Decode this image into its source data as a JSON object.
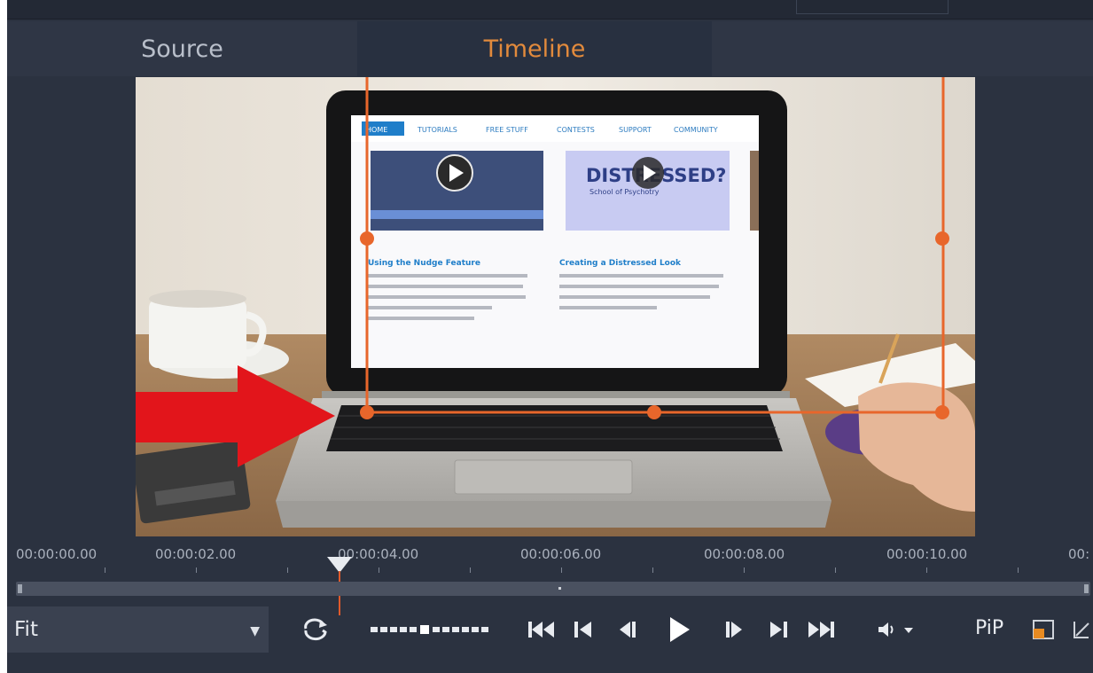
{
  "tabs": {
    "source_label": "Source",
    "timeline_label": "Timeline"
  },
  "timecodes": [
    "00:00:00.00",
    "00:00:02.00",
    "00:00:04.00",
    "00:00:06.00",
    "00:00:08.00",
    "00:00:10.00",
    "00:"
  ],
  "preview": {
    "laptop_site": {
      "nav": [
        "HOME",
        "TUTORIALS",
        "FREE STUFF",
        "CONTESTS",
        "SUPPORT",
        "COMMUNITY"
      ],
      "thumb2_text": "DISTRESSED?",
      "thumb2_sub": "School of Psychotry",
      "post1_title": "Using the Nudge Feature",
      "post2_title": "Creating a Distressed Look"
    }
  },
  "controls": {
    "zoom_value": "Fit",
    "pip_label": "PiP"
  },
  "colors": {
    "accent_orange": "#e28a3c",
    "crop_orange": "#e8662b",
    "arrow_red": "#e2151b",
    "app_bg": "#2b3240"
  },
  "icons": [
    "loop-icon",
    "jog-slider-icon",
    "go-to-start-icon",
    "previous-marker-icon",
    "step-back-icon",
    "play-icon",
    "step-forward-icon",
    "next-marker-icon",
    "go-to-end-icon",
    "volume-icon",
    "crop-icon"
  ]
}
